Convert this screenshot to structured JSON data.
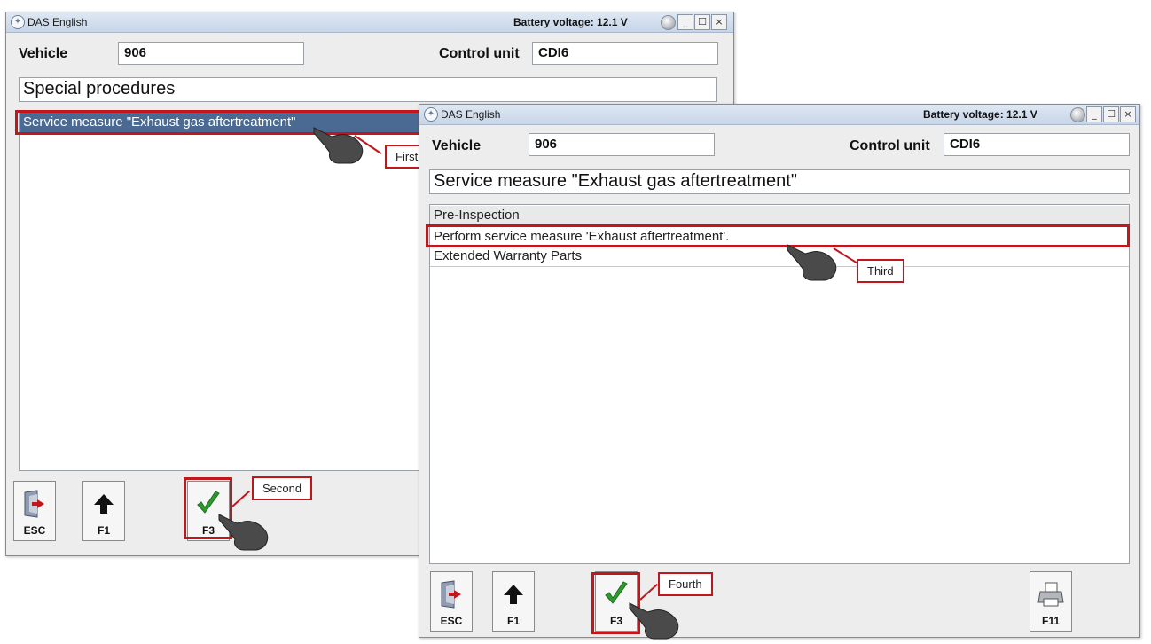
{
  "window1": {
    "title": "DAS English",
    "battery": "Battery voltage: 12.1 V",
    "vehicle_label": "Vehicle",
    "vehicle_value": "906",
    "control_unit_label": "Control unit",
    "control_unit_value": "CDI6",
    "heading": "Special procedures",
    "items": [
      "Service measure \"Exhaust gas aftertreatment\""
    ],
    "buttons": {
      "esc": "ESC",
      "f1": "F1",
      "f3": "F3"
    }
  },
  "window2": {
    "title": "DAS English",
    "battery": "Battery voltage: 12.1 V",
    "vehicle_label": "Vehicle",
    "vehicle_value": "906",
    "control_unit_label": "Control unit",
    "control_unit_value": "CDI6",
    "heading": "Service measure \"Exhaust gas aftertreatment\"",
    "group": "Pre-Inspection",
    "items": [
      "Perform service measure 'Exhaust aftertreatment'.",
      "Extended Warranty Parts"
    ],
    "buttons": {
      "esc": "ESC",
      "f1": "F1",
      "f3": "F3",
      "f11": "F11"
    }
  },
  "titlebar_controls": {
    "minimize": "_",
    "maximize": "☐",
    "close": "×"
  },
  "callouts": {
    "first": "First",
    "second": "Second",
    "third": "Third",
    "fourth": "Fourth"
  },
  "colors": {
    "highlight_red": "#c0161c",
    "selection_blue": "#4a6a93",
    "check_green": "#2f9a2f"
  },
  "icons": [
    "das-logo-icon",
    "battery-led-icon",
    "exit-door-icon",
    "arrow-up-icon",
    "checkmark-icon",
    "printer-icon",
    "pointing-hand-icon"
  ]
}
